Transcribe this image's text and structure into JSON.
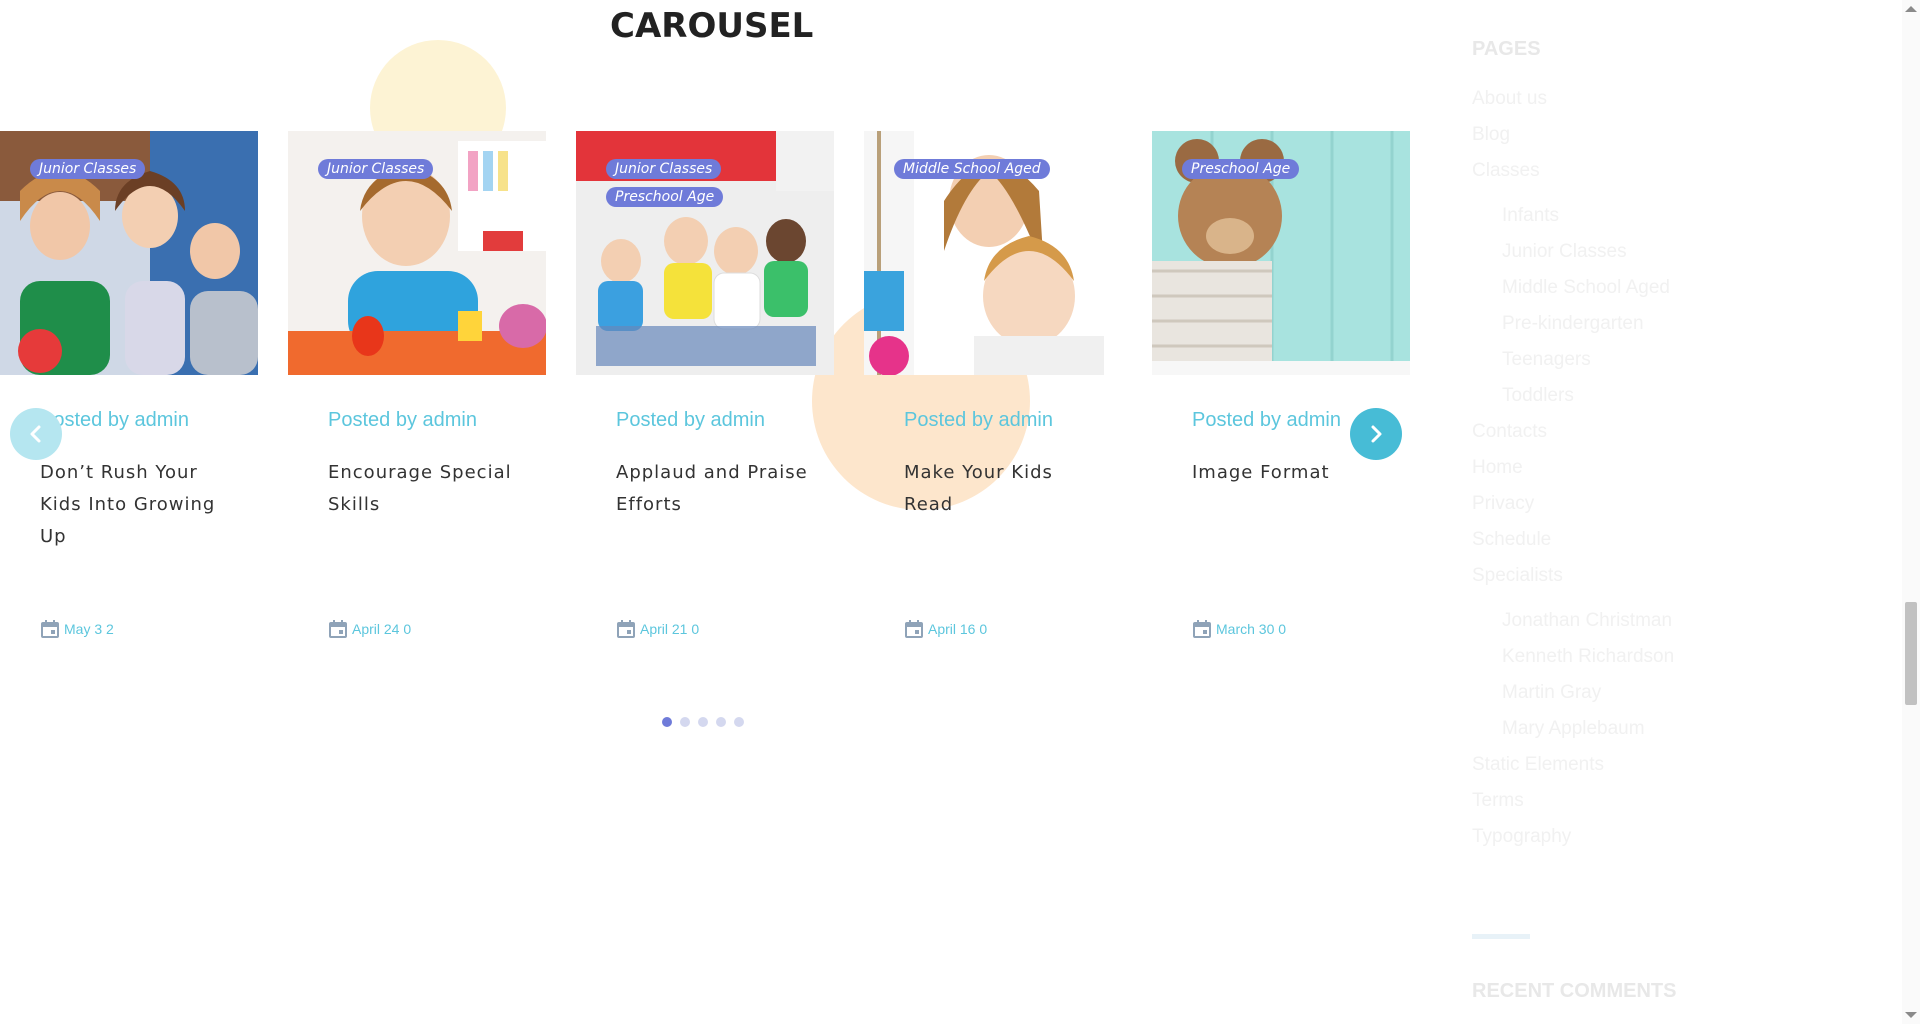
{
  "section": {
    "title": "CAROUSEL"
  },
  "cards": [
    {
      "tags": [
        "Junior Classes"
      ],
      "posted": "Posted by admin",
      "title": "Don’t Rush Your Kids Into Growing Up",
      "date": "May 3 2",
      "image": "kids-group-photo"
    },
    {
      "tags": [
        "Junior Classes"
      ],
      "posted": "Posted by admin",
      "title": "Encourage Special Skills",
      "date": "April 24 0",
      "image": "boy-painting-photo"
    },
    {
      "tags": [
        "Junior Classes",
        "Preschool Age"
      ],
      "posted": "Posted by admin",
      "title": "Applaud and Praise Efforts",
      "date": "April 21 0",
      "image": "kids-cheering-photo"
    },
    {
      "tags": [
        "Middle School Aged"
      ],
      "posted": "Posted by admin",
      "title": "Make Your Kids Read",
      "date": "April 16 0",
      "image": "teacher-boy-photo"
    },
    {
      "tags": [
        "Preschool Age"
      ],
      "posted": "Posted by admin",
      "title": "Image Format",
      "date": "March 30 0",
      "image": "teddy-basket-photo"
    }
  ],
  "carousel": {
    "pages": 5,
    "active_page": 1,
    "prev_icon": "chevron-left-icon",
    "next_icon": "chevron-right-icon"
  },
  "sidebar": {
    "pages_heading": "PAGES",
    "pages": [
      {
        "label": "About us",
        "level": 0
      },
      {
        "label": "Blog",
        "level": 0
      },
      {
        "label": "Classes",
        "level": 0
      },
      {
        "label": "Infants",
        "level": 1
      },
      {
        "label": "Junior Classes",
        "level": 1
      },
      {
        "label": "Middle School Aged",
        "level": 1
      },
      {
        "label": "Pre-kindergarten",
        "level": 1
      },
      {
        "label": "Teenagers",
        "level": 1
      },
      {
        "label": "Toddlers",
        "level": 1
      },
      {
        "label": "Contacts",
        "level": 0
      },
      {
        "label": "Home",
        "level": 0
      },
      {
        "label": "Privacy",
        "level": 0
      },
      {
        "label": "Schedule",
        "level": 0
      },
      {
        "label": "Specialists",
        "level": 0
      },
      {
        "label": "Jonathan Christman",
        "level": 1
      },
      {
        "label": "Kenneth Richardson",
        "level": 1
      },
      {
        "label": "Martin Gray",
        "level": 1
      },
      {
        "label": "Mary Applebaum",
        "level": 1
      },
      {
        "label": "Static Elements",
        "level": 0
      },
      {
        "label": "Terms",
        "level": 0
      },
      {
        "label": "Typography",
        "level": 0
      }
    ],
    "recent_heading": "RECENT COMMENTS"
  },
  "colors": {
    "accent_blue": "#5cc6dd",
    "tag_purple": "#6f7bd9",
    "heading": "#222222"
  }
}
